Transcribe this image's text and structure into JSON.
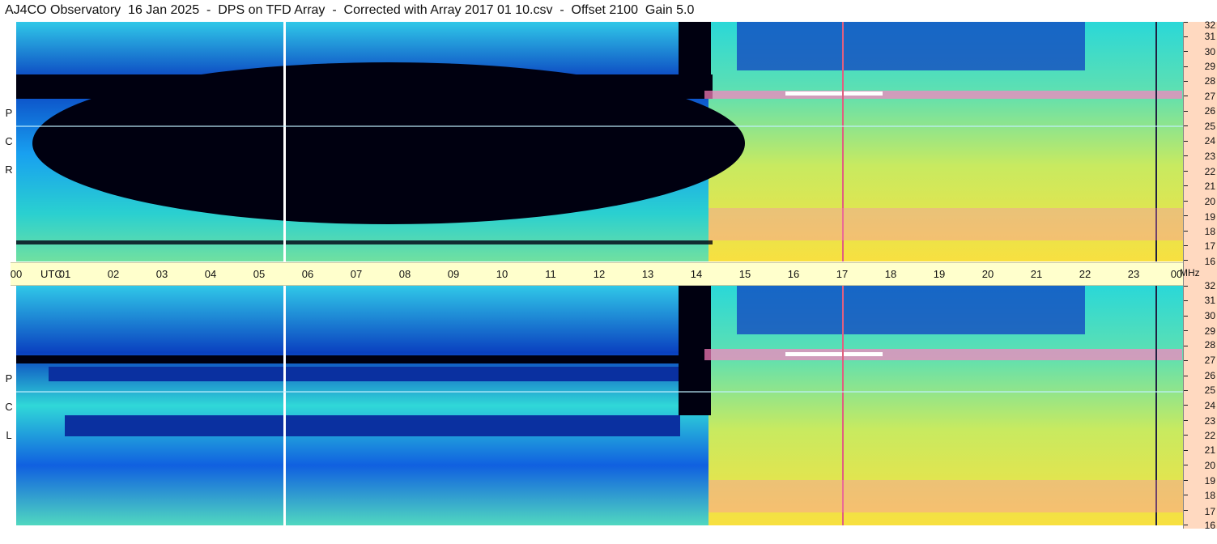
{
  "header": {
    "title": "AJ4CO Observatory  16 Jan 2025  -  DPS on TFD Array  -  Corrected with Array 2017 01 10.csv  -  Offset 2100  Gain 5.0"
  },
  "panels": {
    "rcp": {
      "letters": [
        "P",
        "C",
        "R"
      ]
    },
    "lcp": {
      "letters": [
        "P",
        "C",
        "L"
      ]
    }
  },
  "time_axis": {
    "utc_label": "UTC",
    "hours": [
      "00",
      "01",
      "02",
      "03",
      "04",
      "05",
      "06",
      "07",
      "08",
      "09",
      "10",
      "11",
      "12",
      "13",
      "14",
      "15",
      "16",
      "17",
      "18",
      "19",
      "20",
      "21",
      "22",
      "23",
      "00"
    ]
  },
  "freq_axis": {
    "unit": "MHz",
    "ticks": [
      "32",
      "31",
      "30",
      "29",
      "28",
      "27",
      "26",
      "25",
      "24",
      "23",
      "22",
      "21",
      "20",
      "19",
      "18",
      "17",
      "16"
    ]
  },
  "colors": {
    "spectrogram_low": "#000010",
    "spectrogram_mid": "#18a0f0",
    "spectrogram_high": "#f8e040",
    "utc_strip": "#ffffcc",
    "mhz_axis": "#ffd9c0"
  }
}
